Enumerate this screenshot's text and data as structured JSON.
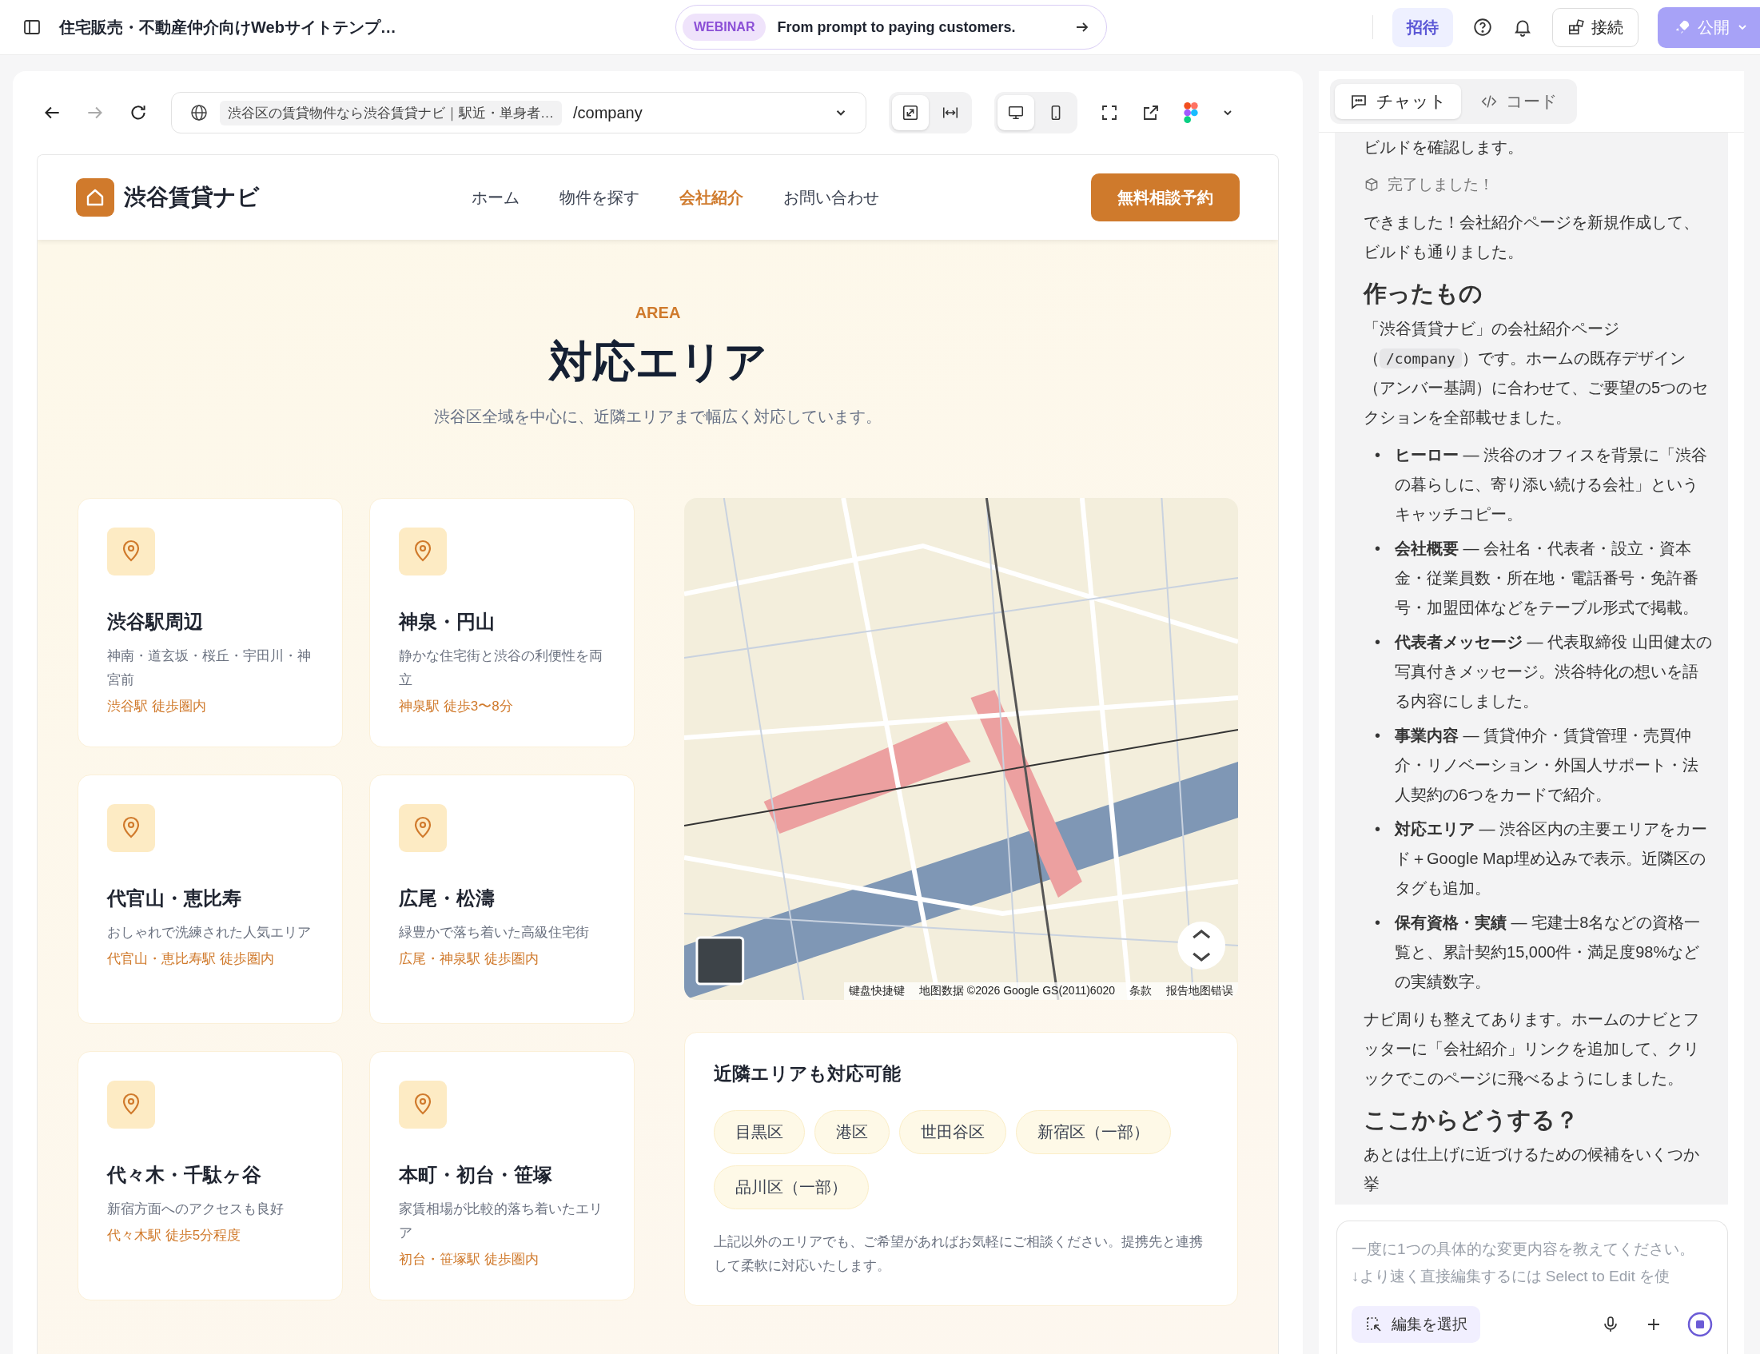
{
  "topbar": {
    "title": "住宅販売・不動産仲介向けWebサイトテンプ…",
    "promo": {
      "badge": "WEBINAR",
      "text": "From prompt to paying customers."
    },
    "invite": "招待",
    "connect": "接続",
    "publish": "公開"
  },
  "preview": {
    "url": {
      "title": "渋谷区の賃貸物件なら渋谷賃貸ナビ｜駅近・単身者…",
      "path": "/company"
    },
    "width_modes": [
      {
        "kind": "fit",
        "selected": true
      },
      {
        "kind": "stretch",
        "selected": false
      }
    ],
    "devices": [
      {
        "kind": "desktop",
        "selected": true
      },
      {
        "kind": "mobile",
        "selected": false
      }
    ]
  },
  "site": {
    "brand": "渋谷賃貸ナビ",
    "nav": [
      {
        "label": "ホーム",
        "selected": false
      },
      {
        "label": "物件を探す",
        "selected": false
      },
      {
        "label": "会社紹介",
        "selected": true
      },
      {
        "label": "お問い合わせ",
        "selected": false
      }
    ],
    "cta": "無料相談予約",
    "section": {
      "eyebrow": "AREA",
      "title": "対応エリア",
      "subtitle": "渋谷区全域を中心に、近隣エリアまで幅広く対応しています。"
    },
    "areas": [
      {
        "name": "渋谷駅周辺",
        "desc": "神南・道玄坂・桜丘・宇田川・神宮前",
        "access": "渋谷駅 徒歩圏内"
      },
      {
        "name": "神泉・円山",
        "desc": "静かな住宅街と渋谷の利便性を両立",
        "access": "神泉駅 徒歩3〜8分"
      },
      {
        "name": "代官山・恵比寿",
        "desc": "おしゃれで洗練された人気エリア",
        "access": "代官山・恵比寿駅 徒歩圏内"
      },
      {
        "name": "広尾・松濤",
        "desc": "緑豊かで落ち着いた高級住宅街",
        "access": "広尾・神泉駅 徒歩圏内"
      },
      {
        "name": "代々木・千駄ヶ谷",
        "desc": "新宿方面へのアクセスも良好",
        "access": "代々木駅 徒歩5分程度"
      },
      {
        "name": "本町・初台・笹塚",
        "desc": "家賃相場が比較的落ち着いたエリア",
        "access": "初台・笹塚駅 徒歩圏内"
      }
    ],
    "map_attribution": [
      "键盘快捷键",
      "地图数据 ©2026 Google GS(2011)6020",
      "条款",
      "报告地图错误"
    ],
    "nearby": {
      "title": "近隣エリアも対応可能",
      "tags": [
        "目黒区",
        "港区",
        "世田谷区",
        "新宿区（一部）",
        "品川区（一部）"
      ],
      "note": "上記以外のエリアでも、ご希望があればお気軽にご相談ください。提携先と連携して柔軟に対応いたします。"
    }
  },
  "chat": {
    "tabs": [
      {
        "label": "チャット",
        "kind": "chat",
        "selected": true
      },
      {
        "label": "コード",
        "kind": "code",
        "selected": false
      }
    ],
    "messages": [
      {
        "kind": "text",
        "text": "ビルドを確認します。"
      },
      {
        "kind": "status",
        "text": "完了しました！"
      },
      {
        "kind": "text",
        "text": "できました！会社紹介ページを新規作成して、ビルドも通りました。"
      },
      {
        "kind": "heading",
        "text": "作ったもの"
      },
      {
        "kind": "code_text",
        "before": "「渋谷賃貸ナビ」の会社紹介ページ（",
        "code": "/company",
        "after": "）です。ホームの既存デザイン（アンバー基調）に合わせて、ご要望の5つのセクションを全部載せました。"
      },
      {
        "kind": "bullets",
        "marker": "•",
        "items": [
          "**ヒーロー** — 渋谷のオフィスを背景に「渋谷の暮らしに、寄り添い続ける会社」というキャッチコピー。",
          "**会社概要** — 会社名・代表者・設立・資本金・従業員数・所在地・電話番号・免許番号・加盟団体などをテーブル形式で掲載。",
          "**代表者メッセージ** — 代表取締役 山田健太の写真付きメッセージ。渋谷特化の想いを語る内容にしました。",
          "**事業内容** — 賃貸仲介・賃貸管理・売買仲介・リノベーション・外国人サポート・法人契約の6つをカードで紹介。",
          "**対応エリア** — 渋谷区内の主要エリアをカード＋Google Map埋め込みで表示。近隣区のタグも追加。",
          "**保有資格・実績** — 宅建士8名などの資格一覧と、累計契約15,000件・満足度98%などの実績数字。"
        ]
      },
      {
        "kind": "text",
        "text": "ナビ周りも整えてあります。ホームのナビとフッターに「会社紹介」リンクを追加して、クリックでこのページに飛べるようにしました。"
      },
      {
        "kind": "heading",
        "text": "ここからどうする？"
      },
      {
        "kind": "text",
        "text": "あとは仕上げに近づけるための候補をいくつか挙"
      }
    ],
    "input": {
      "placeholder": "一度に1つの具体的な変更内容を教えてください。\n↓より速く直接編集するには Select to Edit を使",
      "select_button": "編集を選択"
    }
  }
}
